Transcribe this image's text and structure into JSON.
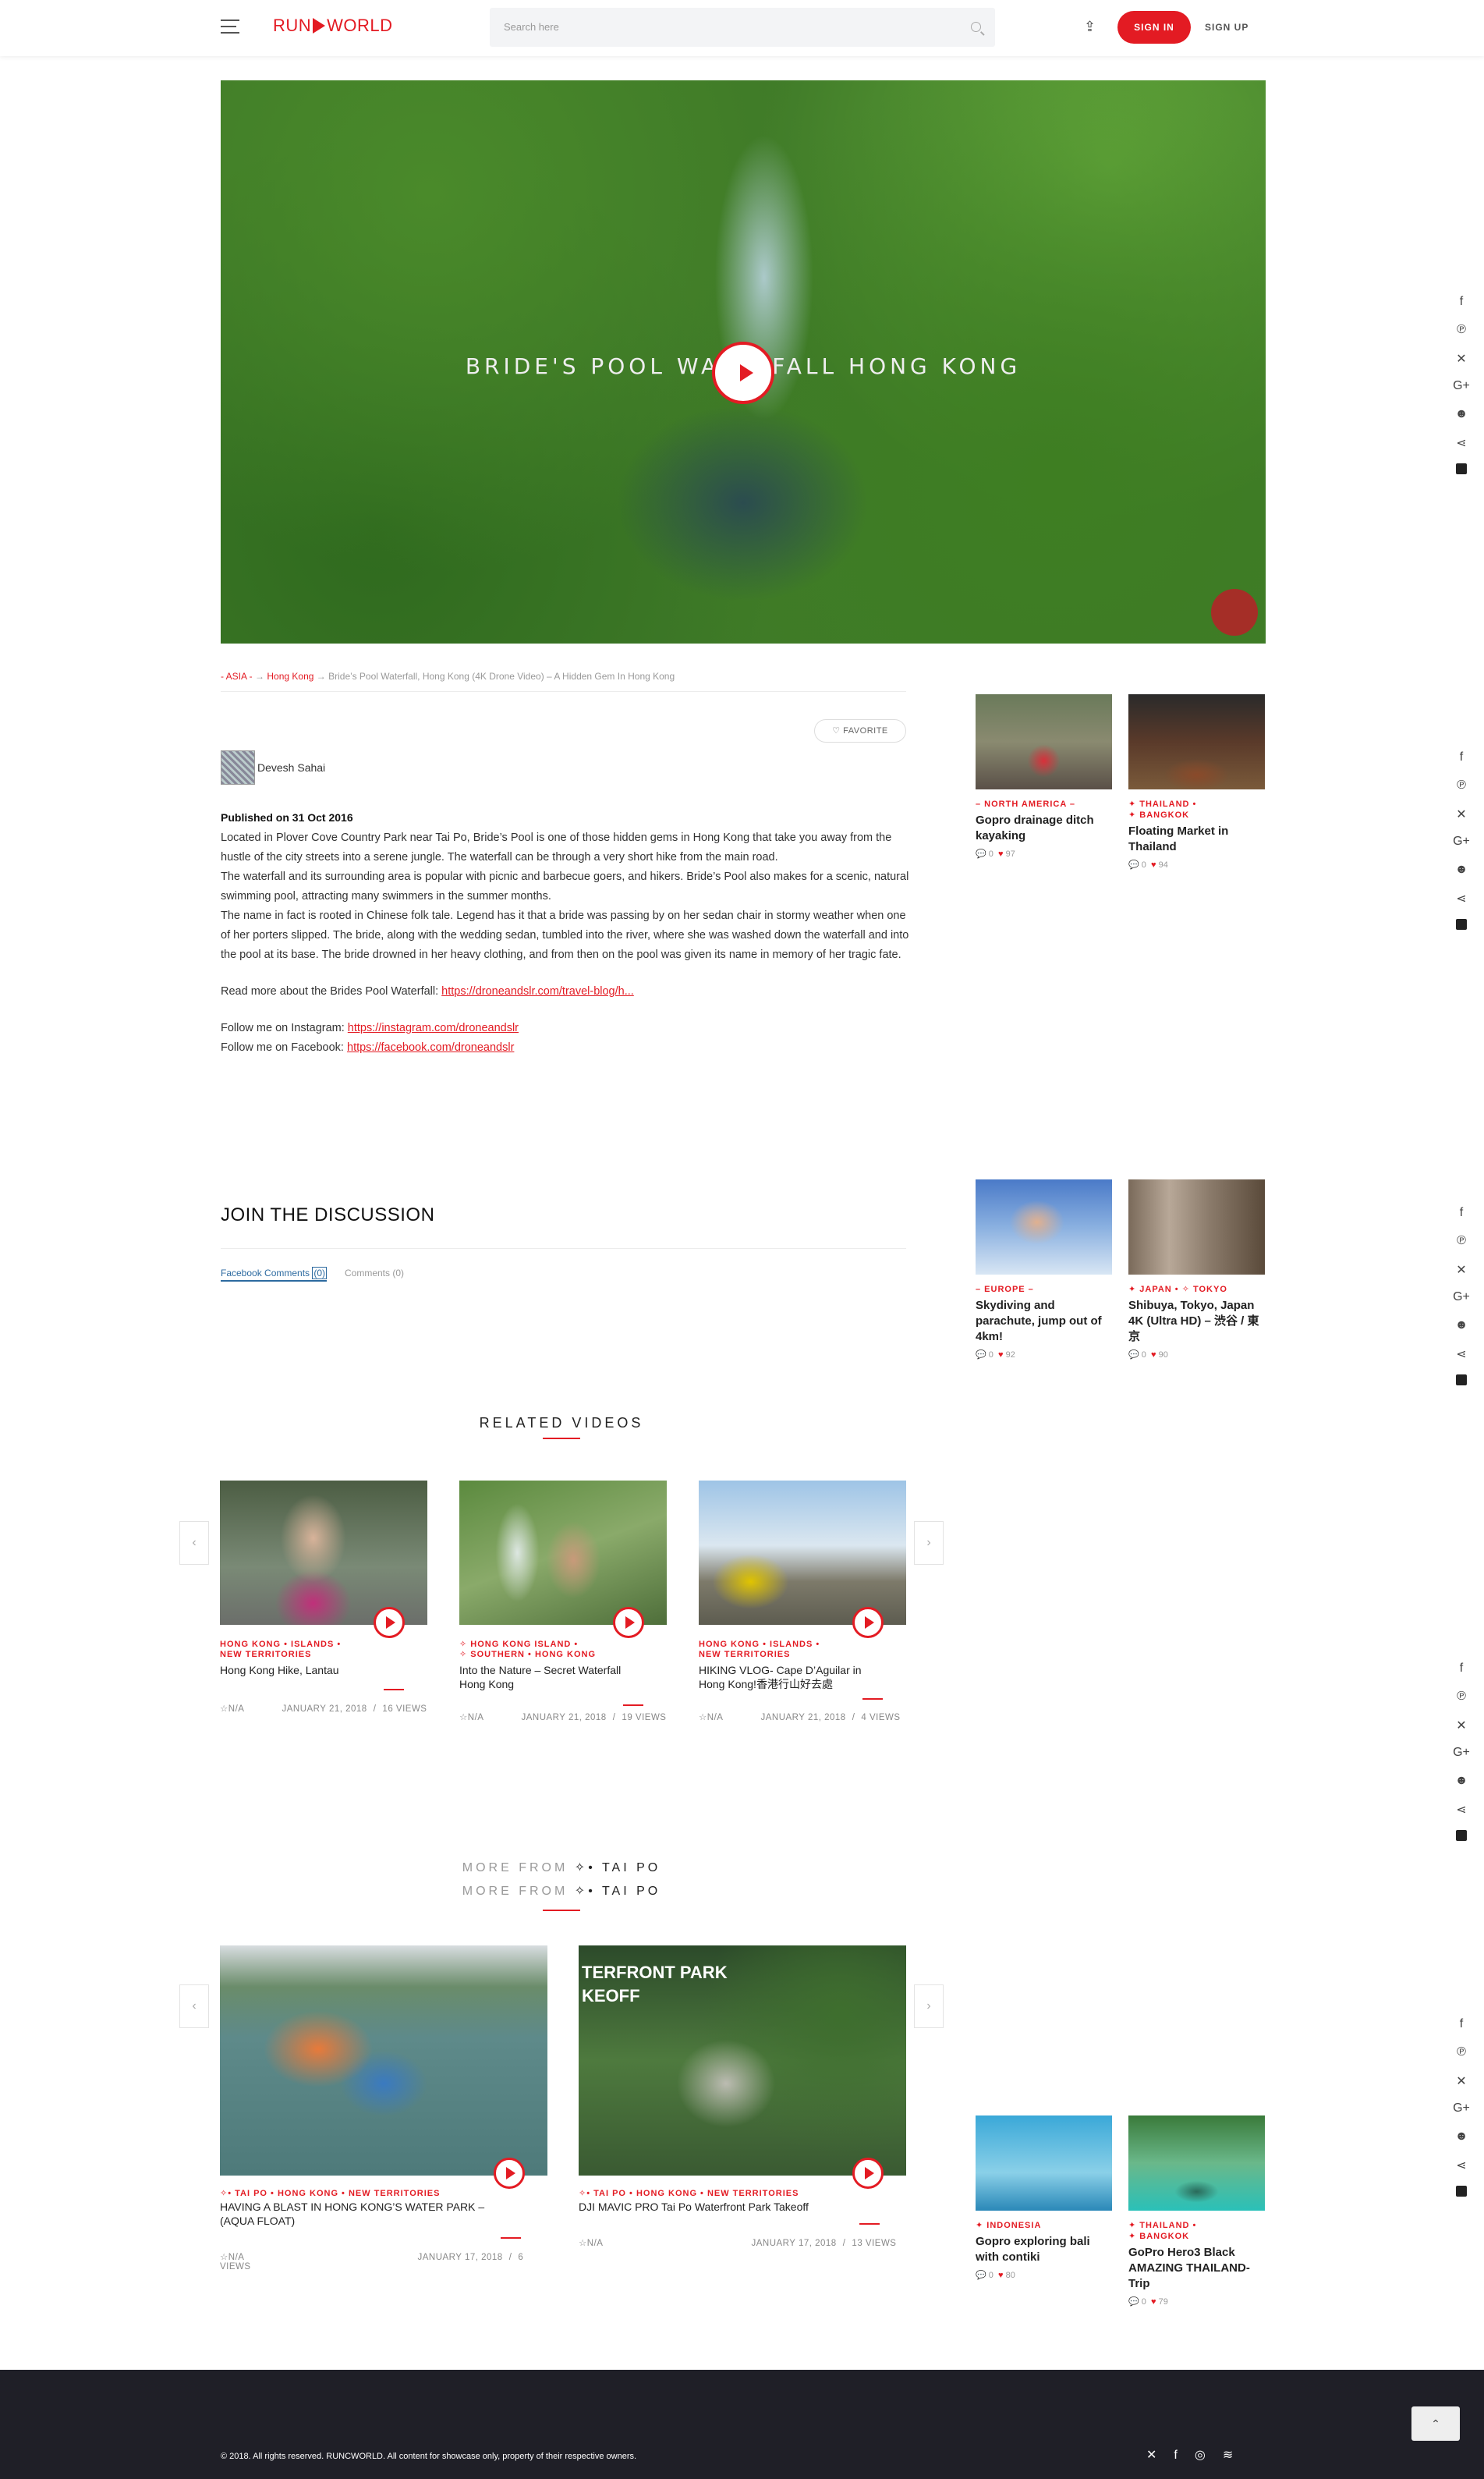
{
  "header": {
    "logo_left": "RUN",
    "logo_right": "WORLD",
    "search_placeholder": "Search here",
    "signin": "SIGN IN",
    "signup": "SIGN UP"
  },
  "hero": {
    "overlay_text": "BRIDE'S POOL WATERFALL HONG KONG"
  },
  "breadcrumb": {
    "asia": "- ASIA -",
    "sep1": "→",
    "hongkong": "Hong Kong",
    "sep2": "→",
    "current": "Bride’s Pool Waterfall, Hong Kong (4K Drone Video) – A Hidden Gem In Hong Kong"
  },
  "favorite_label": "FAVORITE",
  "author": "Devesh Sahai",
  "published": "Published on 31 Oct 2016",
  "body": {
    "p1": "Located in Plover Cove Country Park near Tai Po, Bride’s Pool is one of those hidden gems in Hong Kong that take you away from the hustle of the city streets into a serene jungle. The waterfall can be through a very short hike from the main road.",
    "p2": "The waterfall and its surrounding area is popular with picnic and barbecue goers, and hikers. Bride’s Pool also makes for a scenic, natural swimming pool, attracting many swimmers in the summer months.",
    "p3": "The name in fact is rooted in Chinese folk tale. Legend has it that a bride was passing by on her sedan chair in stormy weather when one of her porters slipped. The bride, along with the wedding sedan, tumbled into the river, where she was washed down the waterfall and into the pool at its base. The bride drowned in her heavy clothing, and from then on the pool was given its name in memory of her tragic fate.",
    "readmore_label": "Read more about the Brides Pool Waterfall: ",
    "readmore_link": "https://droneandslr.com/travel-blog/h...",
    "instagram_label": "Follow me on Instagram: ",
    "instagram_link": "https://instagram.com/droneandslr",
    "facebook_label": "Follow me on Facebook: ",
    "facebook_link": "https://facebook.com/droneandslr"
  },
  "discussion": {
    "title": "JOIN THE DISCUSSION",
    "tab_facebook": "Facebook Comments",
    "tab_facebook_count": "(0)",
    "tab_comments": "Comments (0)"
  },
  "related": {
    "title": "RELATED VIDEOS",
    "items": [
      {
        "cats1": "HONG KONG   •   ISLANDS   •",
        "cats2": "NEW TERRITORIES",
        "title1": "Hong Kong Hike, Lantau",
        "title2": "",
        "rating": "☆N/A",
        "date": "JANUARY 21, 2018",
        "sep": "/",
        "views": "16 VIEWS"
      },
      {
        "cats1": "✧ HONG KONG ISLAND   •",
        "cats2": "✧ SOUTHERN   •   HONG KONG",
        "title1": "Into the Nature – Secret Waterfall",
        "title2": "Hong Kong",
        "rating": "☆N/A",
        "date": "JANUARY 21, 2018",
        "sep": "/",
        "views": "19 VIEWS"
      },
      {
        "cats1": "HONG KONG   •   ISLANDS   •",
        "cats2": "NEW TERRITORIES",
        "title1": "HIKING VLOG- Cape D’Aguilar in",
        "title2": "Hong Kong!香港行山好去處",
        "rating": "☆N/A",
        "date": "JANUARY 21, 2018",
        "sep": "/",
        "views": "4 VIEWS"
      }
    ]
  },
  "more_from": {
    "label": "MORE FROM",
    "place": "✧• TAI PO",
    "items": [
      {
        "cats": "✧• TAI PO   •   HONG KONG   •   NEW TERRITORIES",
        "title1": "HAVING A BLAST IN HONG KONG’S WATER PARK –",
        "title2": "(AQUA FLOAT)",
        "rating": "☆N/A",
        "date": "JANUARY 17, 2018",
        "sep": "/",
        "views": "6 VIEWS"
      },
      {
        "cats": "✧• TAI PO   •   HONG KONG   •   NEW TERRITORIES",
        "title1": "DJI MAVIC PRO Tai Po Waterfront Park Takeoff",
        "title2": "",
        "rating": "☆N/A",
        "date": "JANUARY 17, 2018",
        "sep": "/",
        "views": "13 VIEWS"
      }
    ]
  },
  "sidebar": [
    {
      "cat": "– NORTH AMERICA –",
      "cat2": "",
      "title": "Gopro drainage ditch kayaking",
      "comments": "0",
      "likes": "97"
    },
    {
      "cat": "✦ THAILAND   •",
      "cat2": "✦ BANGKOK",
      "title": "Floating Market in Thailand",
      "comments": "0",
      "likes": "94"
    },
    {
      "cat": "– EUROPE –",
      "cat2": "",
      "title": "Skydiving and parachute, jump out of 4km!",
      "comments": "0",
      "likes": "92"
    },
    {
      "cat": "✦ JAPAN   •   ✧ TOKYO",
      "cat2": "",
      "title": "Shibuya, Tokyo, Japan 4K (Ultra HD) – 渋谷 / 東京",
      "comments": "0",
      "likes": "90"
    },
    {
      "cat": "✦ INDONESIA",
      "cat2": "",
      "title": "Gopro exploring bali with contiki",
      "comments": "0",
      "likes": "80"
    },
    {
      "cat": "✦ THAILAND   •",
      "cat2": "✦ BANGKOK",
      "title": "GoPro Hero3 Black AMAZING THAILAND-Trip",
      "comments": "0",
      "likes": "79"
    }
  ],
  "footer": {
    "copyright": "© 2018. All rights reserved. RUNCWORLD. All content for showcase only, property of their respective owners.",
    "to_top": "⌃"
  }
}
